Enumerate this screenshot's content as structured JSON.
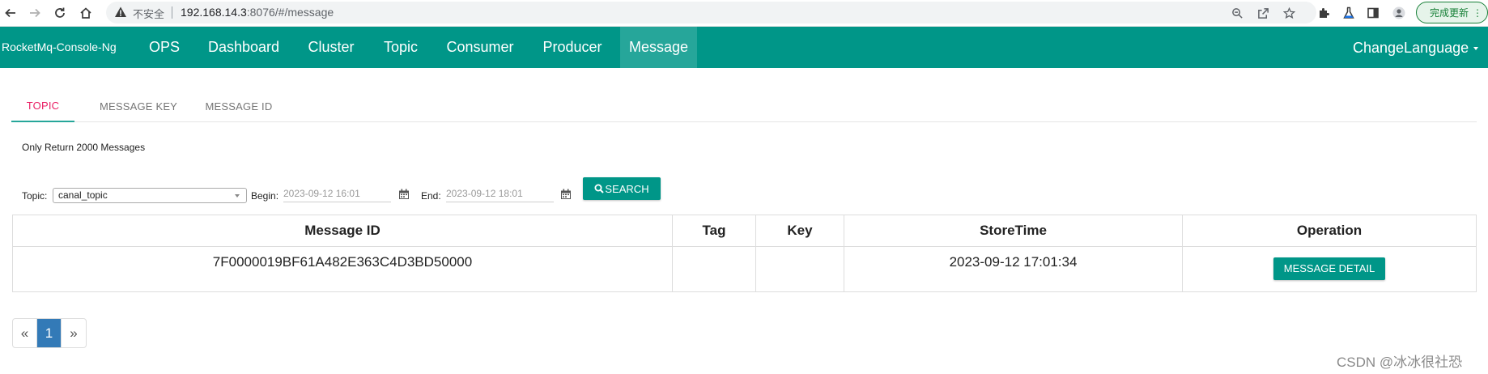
{
  "browser": {
    "insecure_label": "不安全",
    "url_host": "192.168.14.3",
    "url_rest": ":8076/#/message",
    "update_label": "完成更新",
    "update_menu": "⋮"
  },
  "navbar": {
    "brand": "RocketMq-Console-Ng",
    "items": [
      {
        "label": "OPS"
      },
      {
        "label": "Dashboard"
      },
      {
        "label": "Cluster"
      },
      {
        "label": "Topic"
      },
      {
        "label": "Consumer"
      },
      {
        "label": "Producer"
      },
      {
        "label": "Message",
        "active": true
      }
    ],
    "change_language": "ChangeLanguage"
  },
  "tabs": [
    {
      "label": "TOPIC",
      "active": true
    },
    {
      "label": "MESSAGE KEY"
    },
    {
      "label": "MESSAGE ID"
    }
  ],
  "note": "Only Return 2000 Messages",
  "search": {
    "topic_label": "Topic:",
    "topic_value": "canal_topic",
    "begin_label": "Begin:",
    "begin_value": "2023-09-12 16:01",
    "end_label": "End:",
    "end_value": "2023-09-12 18:01",
    "search_label": "SEARCH"
  },
  "table": {
    "headers": [
      "Message ID",
      "Tag",
      "Key",
      "StoreTime",
      "Operation"
    ],
    "rows": [
      {
        "message_id": "7F0000019BF61A482E363C4D3BD50000",
        "tag": "",
        "key": "",
        "store_time": "2023-09-12 17:01:34",
        "operation": "MESSAGE DETAIL"
      }
    ]
  },
  "pagination": {
    "prev": "«",
    "current": "1",
    "next": "»"
  },
  "watermark": "CSDN @冰冰很社恐",
  "colors": {
    "primary": "#009688",
    "active_nav": "#26a69a",
    "tab_active_text": "#e91e63",
    "page_active": "#337ab7"
  }
}
